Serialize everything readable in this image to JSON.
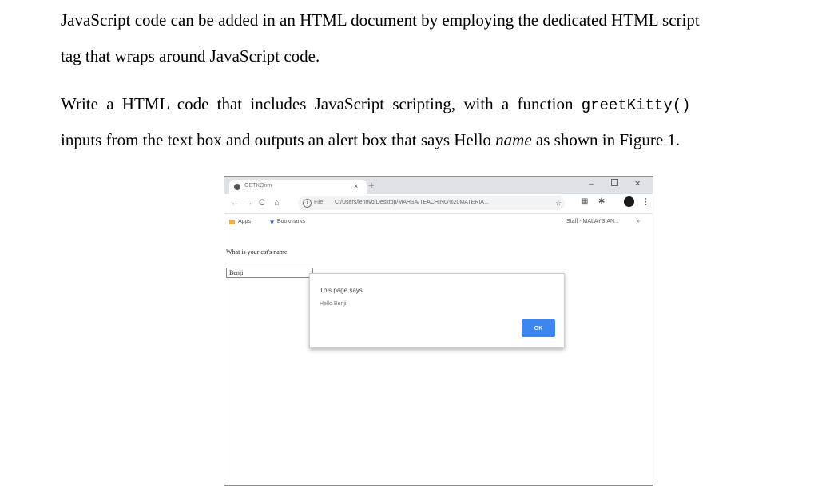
{
  "document": {
    "para1_line1": "JavaScript code can be added in an HTML document by employing the dedicated HTML script",
    "para1_line2": "tag that wraps around JavaScript code.",
    "para2_line1_text": "Write a HTML code that includes JavaScript scripting, with a function",
    "para2_line1_code": "greetKitty()",
    "para2_line2_before": "inputs from the text box and outputs an alert box that says Hello",
    "para2_line2_italic": "name",
    "para2_line2_after": "as shown in Figure 1."
  },
  "browser": {
    "tab_title": "GETKOnm",
    "tab_close": "×",
    "new_tab": "+",
    "window_controls": {
      "minimize": "–",
      "close": "✕"
    },
    "nav": {
      "back": "←",
      "forward": "→",
      "reload": "C",
      "home": "⌂"
    },
    "address": {
      "scheme": "File",
      "url": "C:/Users/lenovo/Desktop/MAHSA/TEACHING%20MATERIA..."
    },
    "bookmarks": {
      "apps": "Apps",
      "bookmarks": "Bookmarks",
      "right": "Staff - MALAYSIAN..."
    },
    "icons": [
      "info-icon",
      "star-icon",
      "extension-icon",
      "puzzle-icon",
      "profile-avatar",
      "menu-dots-icon"
    ]
  },
  "page": {
    "question_label": "What is your cat's name",
    "input_value": "Benji"
  },
  "alert": {
    "title": "This page says",
    "message": "Hello Benji",
    "ok_label": "OK"
  },
  "colors": {
    "ok_button": "#3d86f2",
    "tab_strip": "#dee1e6",
    "omnibox": "#f1f3f4"
  }
}
